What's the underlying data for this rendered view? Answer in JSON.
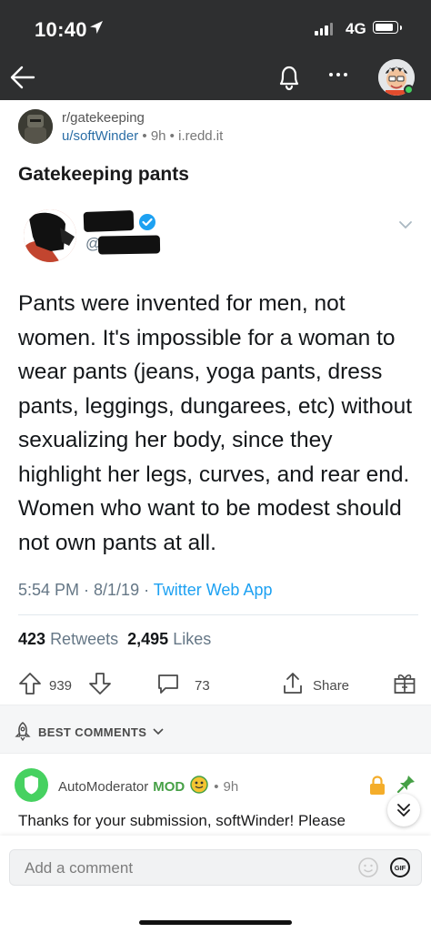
{
  "status_bar": {
    "time": "10:40",
    "network": "4G"
  },
  "post": {
    "subreddit": "r/gatekeeping",
    "author": "u/softWinder",
    "age": "9h",
    "domain": "i.redd.it",
    "title": "Gatekeeping pants",
    "separator": "•"
  },
  "tweet": {
    "handle_prefix": "@",
    "text": "Pants were invented for men, not women. It's impossible for a woman to wear pants (jeans, yoga pants, dress pants, leggings, dungarees, etc) without sexualizing her body, since they highlight her legs, curves, and rear end. Women who want to be modest should not own pants at all.",
    "timestamp": "5:54 PM · 8/1/19 · ",
    "source": "Twitter Web App",
    "retweets_count": "423",
    "retweets_label": "Retweets",
    "likes_count": "2,495",
    "likes_label": "Likes"
  },
  "actions": {
    "score": "939",
    "comments": "73",
    "share_label": "Share"
  },
  "sort": {
    "label": "BEST COMMENTS"
  },
  "comment": {
    "author": "AutoModerator",
    "mod_badge": "MOD",
    "age": "9h",
    "separator": "•",
    "body": "Thanks for your submission, softWinder!  Please"
  },
  "composer": {
    "placeholder": "Add a comment",
    "gif_label": "GIF"
  },
  "colors": {
    "app_bar": "#2e2f30",
    "link_blue": "#2b6ea6",
    "twitter_blue": "#1da1f2",
    "mod_green": "#46d160"
  }
}
